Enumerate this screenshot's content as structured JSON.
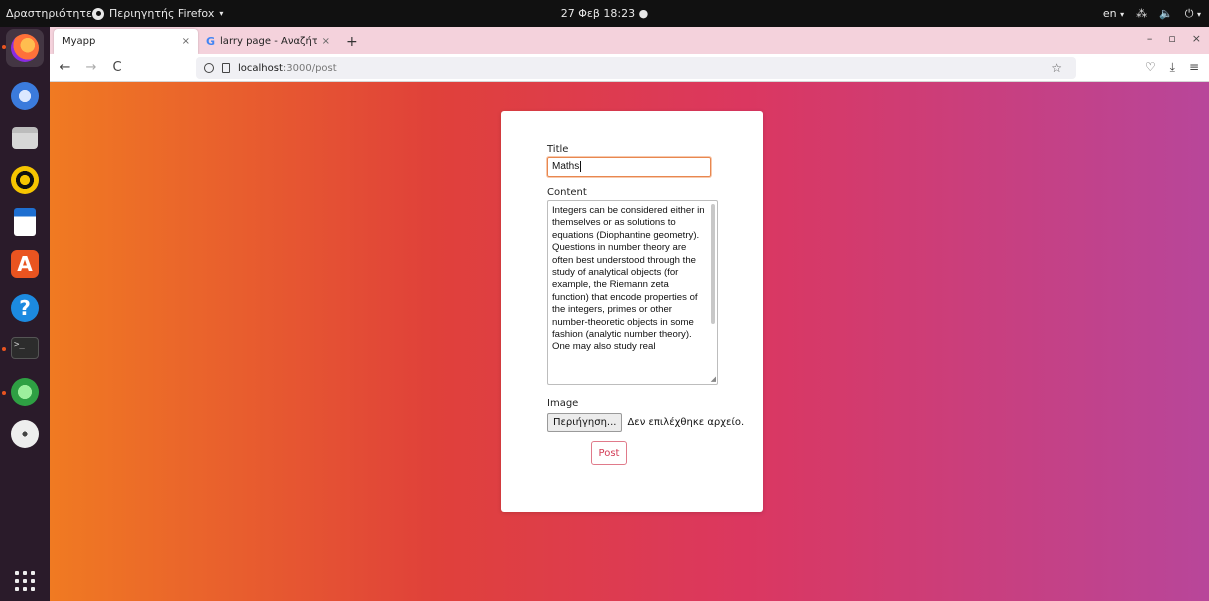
{
  "topbar": {
    "activities": "Δραστηριότητες",
    "app_menu": "Περιηγητής Firefox",
    "clock": "27 Φεβ 18:23",
    "clock_dot": "●",
    "lang": "en",
    "caret": "▾",
    "network_icon": "⁂",
    "volume_icon": "🔈",
    "power_icon": "⏻"
  },
  "tabs": [
    {
      "title": "Myapp",
      "close": "×"
    },
    {
      "title": "larry page - Αναζήτηση G",
      "close": "×"
    }
  ],
  "new_tab": "+",
  "window_controls": {
    "minimize": "–",
    "maximize": "▫",
    "close": "×"
  },
  "nav": {
    "back": "←",
    "forward": "→",
    "reload": "C",
    "url_host": "localhost",
    "url_path": ":3000/post",
    "bookmark_star": "☆",
    "pocket": "♡",
    "download": "⤓",
    "menu": "≡"
  },
  "form": {
    "title_label": "Title",
    "title_value": "Maths",
    "content_label": "Content",
    "content_value": "Integers can be considered either in themselves or as solutions to equations (Diophantine geometry). Questions in number theory are often best understood through the study of analytical objects (for example, the Riemann zeta function) that encode properties of the integers, primes or other number-theoretic objects in some fashion (analytic number theory). One may also study real",
    "image_label": "Image",
    "browse_button": "Περιήγηση...",
    "no_file_text": "Δεν επιλέχθηκε αρχείο.",
    "post_button": "Post"
  },
  "colors": {
    "gradient_start": "#f07a22",
    "gradient_end": "#b8469a",
    "tabbar_bg": "#f4d2dc",
    "accent": "#d23b55"
  }
}
